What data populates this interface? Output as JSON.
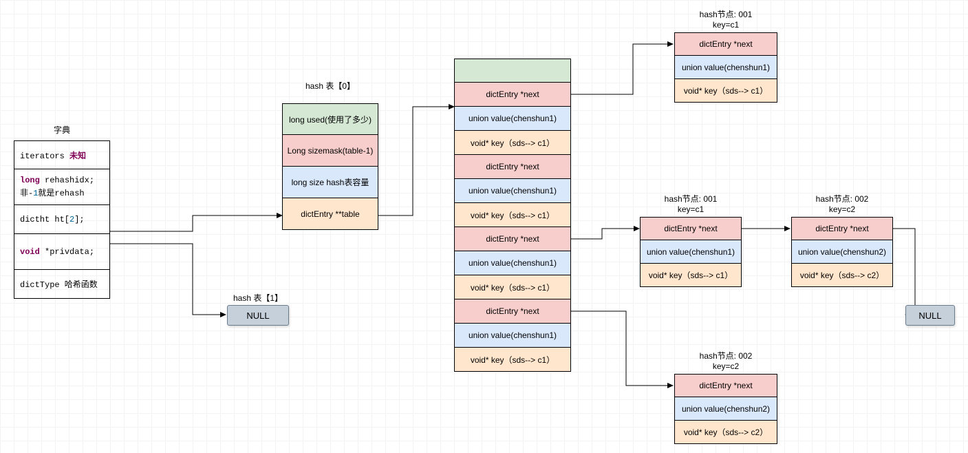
{
  "dict": {
    "title": "字典",
    "rows": [
      {
        "html": "<span class='mono'>iterators <span class='kw'>未知</span></span>"
      },
      {
        "html": "<span class='mono'><span class='kw'>long</span> rehashidx;</span><br><span class='mono'>非-<span class='lit'>1</span>就是rehash</span>"
      },
      {
        "html": "<span class='mono'>dictht ht[<span class='lit'>2</span>];</span>"
      },
      {
        "html": "<span class='mono'><span class='kw'>void</span> *privdata;</span>"
      },
      {
        "html": "<span class='mono'>dictType 哈希函数</span>"
      }
    ]
  },
  "hash0": {
    "title": "hash 表【0】",
    "rows": [
      {
        "cls": "c-green",
        "text": "long used(使用了多少)"
      },
      {
        "cls": "c-red",
        "text": "Long sizemask(table-1)"
      },
      {
        "cls": "c-blue",
        "text": "long size hash表容量"
      },
      {
        "cls": "c-orange",
        "text": "dictEntry **table"
      }
    ]
  },
  "hash1": {
    "title": "hash 表【1】",
    "text": "NULL"
  },
  "buckets": {
    "rows": [
      {
        "cls": "c-green",
        "text": ""
      },
      {
        "cls": "c-red",
        "text": "dictEntry *next"
      },
      {
        "cls": "c-blue",
        "text": "union value(chenshun1)"
      },
      {
        "cls": "c-orange",
        "text": "void* key（sds--> c1）"
      },
      {
        "cls": "c-red",
        "text": "dictEntry *next"
      },
      {
        "cls": "c-blue",
        "text": "union value(chenshun1)"
      },
      {
        "cls": "c-orange",
        "text": "void* key（sds--> c1）"
      },
      {
        "cls": "c-red",
        "text": "dictEntry *next"
      },
      {
        "cls": "c-blue",
        "text": "union value(chenshun1)"
      },
      {
        "cls": "c-orange",
        "text": "void* key（sds--> c1）"
      },
      {
        "cls": "c-red",
        "text": "dictEntry *next"
      },
      {
        "cls": "c-blue",
        "text": "union value(chenshun1)"
      },
      {
        "cls": "c-orange",
        "text": "void* key（sds--> c1）"
      }
    ]
  },
  "nodeA": {
    "title": "hash节点: 001\nkey=c1",
    "rows": [
      {
        "cls": "c-red",
        "text": "dictEntry *next"
      },
      {
        "cls": "c-blue",
        "text": "union value(chenshun1)"
      },
      {
        "cls": "c-orange",
        "text": "void* key（sds--> c1）"
      }
    ]
  },
  "nodeB": {
    "title": "hash节点: 001\nkey=c1",
    "rows": [
      {
        "cls": "c-red",
        "text": "dictEntry *next"
      },
      {
        "cls": "c-blue",
        "text": "union value(chenshun1)"
      },
      {
        "cls": "c-orange",
        "text": "void* key（sds--> c1）"
      }
    ]
  },
  "nodeC": {
    "title": "hash节点: 002\nkey=c2",
    "rows": [
      {
        "cls": "c-red",
        "text": "dictEntry *next"
      },
      {
        "cls": "c-blue",
        "text": "union value(chenshun2)"
      },
      {
        "cls": "c-orange",
        "text": "void* key（sds--> c2）"
      }
    ]
  },
  "nodeD": {
    "title": "hash节点: 002\nkey=c2",
    "rows": [
      {
        "cls": "c-red",
        "text": "dictEntry *next"
      },
      {
        "cls": "c-blue",
        "text": "union value(chenshun2)"
      },
      {
        "cls": "c-orange",
        "text": "void* key（sds--> c2）"
      }
    ]
  },
  "null2": {
    "text": "NULL"
  }
}
